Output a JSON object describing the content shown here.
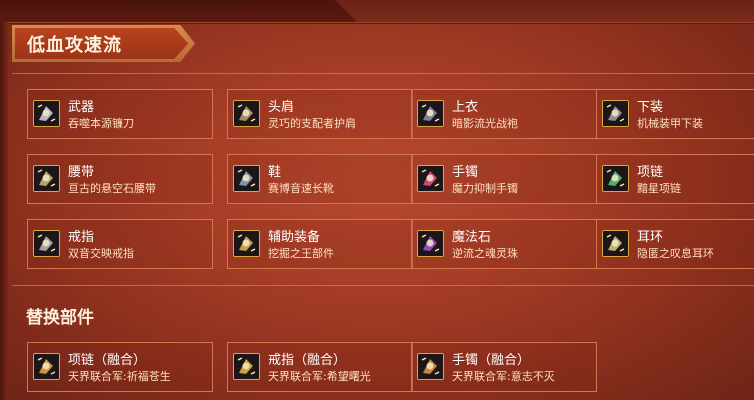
{
  "build_title": "低血攻速流",
  "equipment": [
    {
      "slot": "武器",
      "item": "吞噬本源镰刀",
      "icon": "scythe-icon",
      "accent": "#c9c9d6"
    },
    {
      "slot": "头肩",
      "item": "灵巧的支配者护肩",
      "icon": "shoulder-armor-icon",
      "accent": "#b89a6a"
    },
    {
      "slot": "上衣",
      "item": "暗影流光战袍",
      "icon": "chest-armor-icon",
      "accent": "#8a8aa8"
    },
    {
      "slot": "下装",
      "item": "机械装甲下装",
      "icon": "leg-armor-icon",
      "accent": "#9c9c9c"
    },
    {
      "slot": "腰带",
      "item": "亘古的悬空石腰带",
      "icon": "belt-icon",
      "accent": "#c8b26a"
    },
    {
      "slot": "鞋",
      "item": "赛博音速长靴",
      "icon": "boots-icon",
      "accent": "#8fa0b8"
    },
    {
      "slot": "手镯",
      "item": "魔力抑制手镯",
      "icon": "bracelet-icon",
      "accent": "#e84a8a"
    },
    {
      "slot": "项链",
      "item": "黯星项链",
      "icon": "necklace-icon",
      "accent": "#5cc07a"
    },
    {
      "slot": "戒指",
      "item": "双音交映戒指",
      "icon": "ring-icon",
      "accent": "#b0b0c0"
    },
    {
      "slot": "辅助装备",
      "item": "挖掘之王部件",
      "icon": "drill-icon",
      "accent": "#d8b050"
    },
    {
      "slot": "魔法石",
      "item": "逆流之魂灵珠",
      "icon": "magic-orb-icon",
      "accent": "#a050d0"
    },
    {
      "slot": "耳环",
      "item": "隐匿之叹息耳环",
      "icon": "earring-icon",
      "accent": "#d0c080"
    }
  ],
  "replacement_title": "替换部件",
  "replacements": [
    {
      "slot": "项链（融合）",
      "item": "天界联合军:祈福苍生",
      "icon": "fused-necklace-icon",
      "accent": "#e0a040"
    },
    {
      "slot": "戒指（融合）",
      "item": "天界联合军:希望曙光",
      "icon": "fused-ring-icon",
      "accent": "#e0b040"
    },
    {
      "slot": "手镯（融合）",
      "item": "天界联合军:意志不灭",
      "icon": "fused-bracelet-icon",
      "accent": "#e09040"
    }
  ]
}
